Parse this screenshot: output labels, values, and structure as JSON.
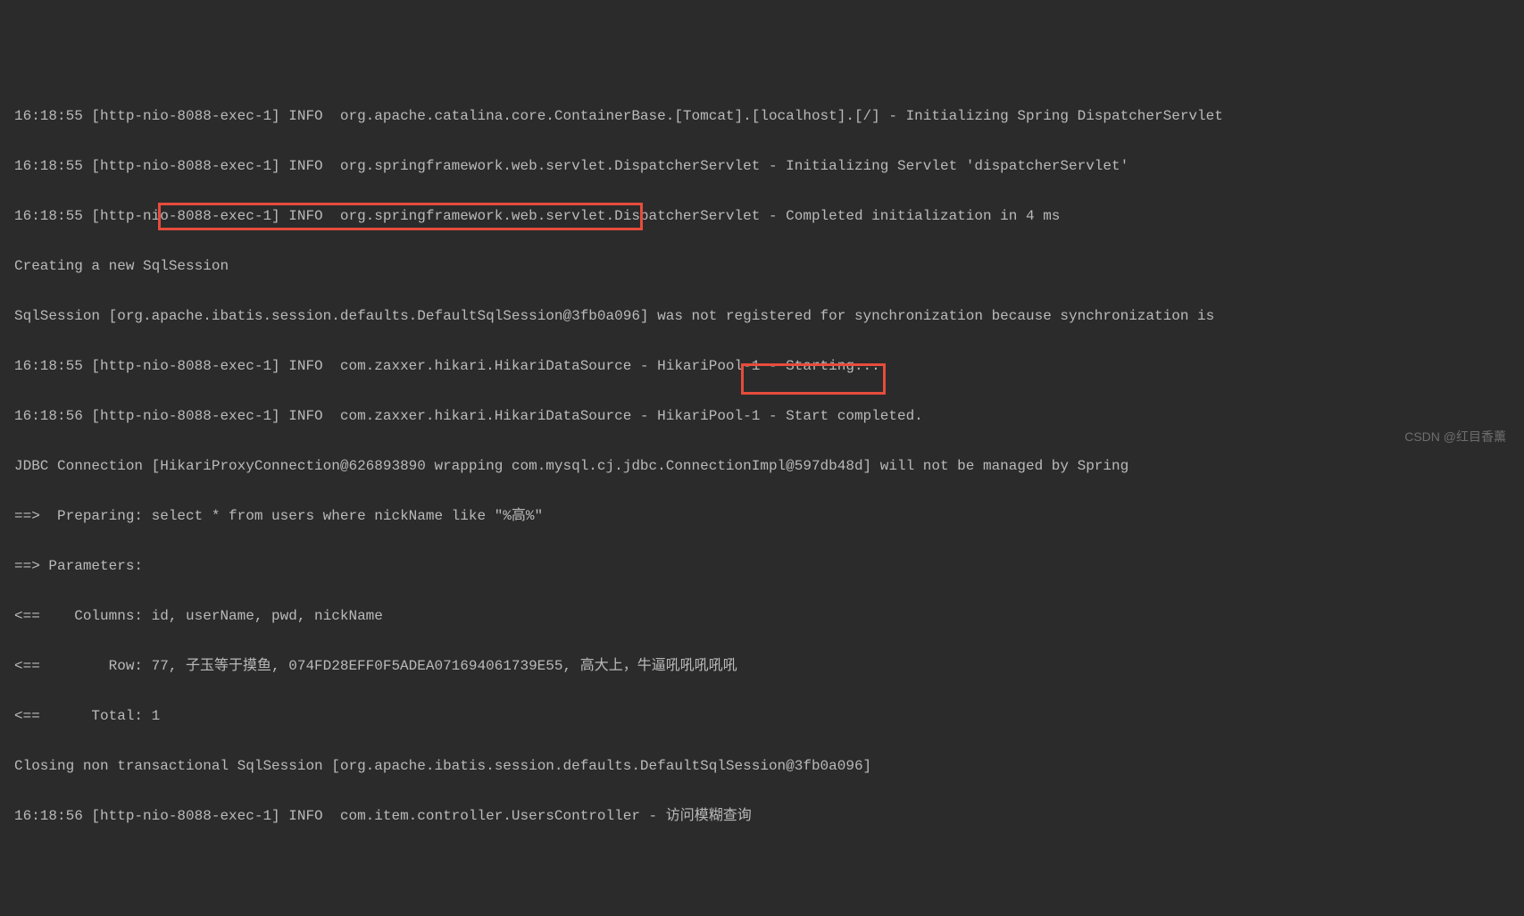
{
  "lines": {
    "l0": "16:18:55 [http-nio-8088-exec-1] INFO  org.apache.catalina.core.ContainerBase.[Tomcat].[localhost].[/] - Initializing Spring DispatcherServlet",
    "l1": "16:18:55 [http-nio-8088-exec-1] INFO  org.springframework.web.servlet.DispatcherServlet - Initializing Servlet 'dispatcherServlet'",
    "l2": "16:18:55 [http-nio-8088-exec-1] INFO  org.springframework.web.servlet.DispatcherServlet - Completed initialization in 4 ms",
    "l3": "Creating a new SqlSession",
    "l4": "SqlSession [org.apache.ibatis.session.defaults.DefaultSqlSession@3fb0a096] was not registered for synchronization because synchronization is",
    "l5": "16:18:55 [http-nio-8088-exec-1] INFO  com.zaxxer.hikari.HikariDataSource - HikariPool-1 - Starting...",
    "l6": "16:18:56 [http-nio-8088-exec-1] INFO  com.zaxxer.hikari.HikariDataSource - HikariPool-1 - Start completed.",
    "l7": "JDBC Connection [HikariProxyConnection@626893890 wrapping com.mysql.cj.jdbc.ConnectionImpl@597db48d] will not be managed by Spring",
    "l8_prefix": "==>  Preparing: ",
    "l8_sql": "select * from users where nickName like \"%高%\" ",
    "l9": "==> Parameters: ",
    "l10": "<==    Columns: id, userName, pwd, nickName",
    "l11": "<==        Row: 77, 子玉等于摸鱼, 074FD28EFF0F5ADEA071694061739E55, 高大上，牛逼吼吼吼吼吼",
    "l12": "<==      Total: 1",
    "l13": "Closing non transactional SqlSession [org.apache.ibatis.session.defaults.DefaultSqlSession@3fb0a096]",
    "l14_prefix": "16:18:56 [http-nio-8088-exec-1] INFO  com.item.controller.UsersController - ",
    "l14_highlight": "访问模糊查询"
  },
  "watermark": "CSDN @红目香薰"
}
